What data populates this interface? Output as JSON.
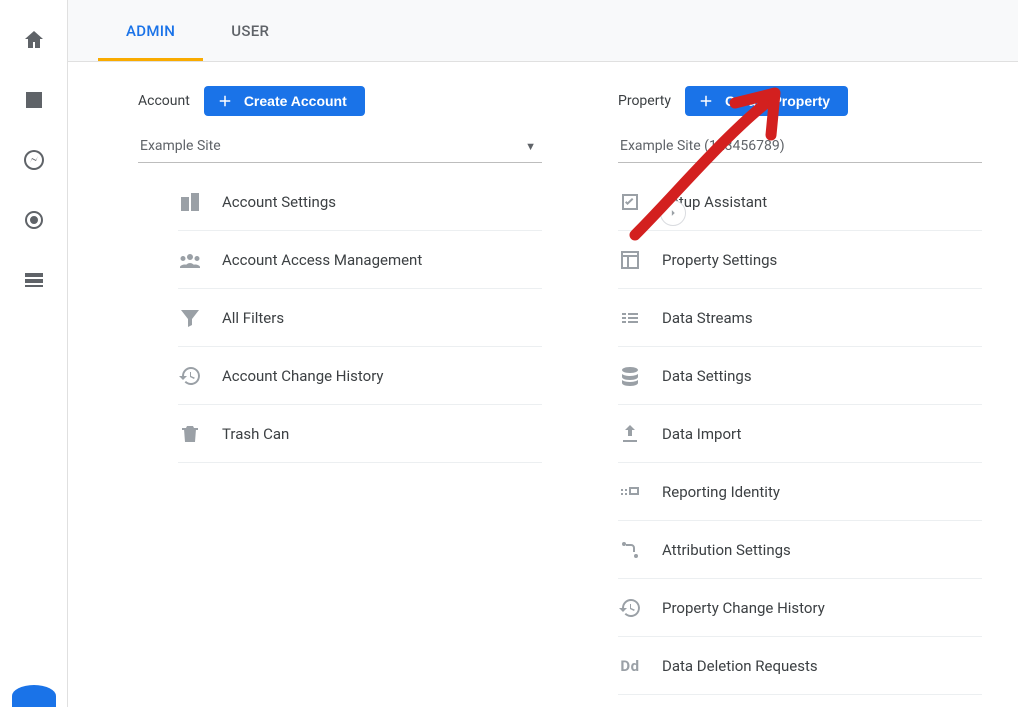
{
  "tabs": {
    "admin": "ADMIN",
    "user": "USER"
  },
  "account": {
    "headerLabel": "Account",
    "createBtn": "Create Account",
    "selected": "Example Site",
    "items": [
      {
        "label": "Account Settings"
      },
      {
        "label": "Account Access Management"
      },
      {
        "label": "All Filters"
      },
      {
        "label": "Account Change History"
      },
      {
        "label": "Trash Can"
      }
    ]
  },
  "property": {
    "headerLabel": "Property",
    "createBtn": "Create Property",
    "selected": "Example Site (123456789)",
    "items": [
      {
        "label": "Setup Assistant"
      },
      {
        "label": "Property Settings"
      },
      {
        "label": "Data Streams"
      },
      {
        "label": "Data Settings"
      },
      {
        "label": "Data Import"
      },
      {
        "label": "Reporting Identity"
      },
      {
        "label": "Attribution Settings"
      },
      {
        "label": "Property Change History"
      },
      {
        "label": "Data Deletion Requests"
      }
    ],
    "ddLetters": "Dd"
  }
}
